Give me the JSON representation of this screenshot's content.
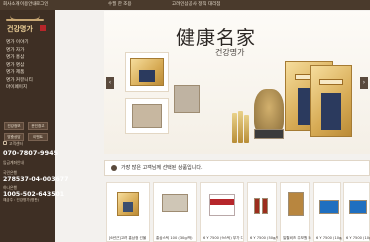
{
  "topbar": {
    "links": [
      "회사소개",
      "이용안내",
      "로그인"
    ],
    "center_link": "수필 한 조용",
    "right_link": "고려인삼공사 정직 대리점"
  },
  "sidebar": {
    "logo_text": "건강명가",
    "menu": [
      "명가 이야기",
      "명가 자가",
      "명가 홍삼",
      "명가 명삼",
      "명가 제품",
      "명가 커뮤니티",
      "마이페이지"
    ],
    "buttons": [
      "건강정보",
      "운인창고",
      "맞춤상담",
      "이벤트"
    ],
    "customer_center_label": "고객센터",
    "phone": "070-7807-9945",
    "quick_label": "입금계좌안내",
    "bank_label": "국민은행",
    "bank_number": "278537-04-003677",
    "bank2_label": "하나은행",
    "bank2_number": "1005-502-643501",
    "holder": "예금주 : 건강명가(명판)"
  },
  "banner": {
    "title_cn": "健康名家",
    "title_kr": "건강명가",
    "prev": "‹",
    "next": "›"
  },
  "promo": {
    "text": "가장 많은 고객님께 선택된 상품입니다."
  },
  "products": [
    {
      "name": "[6년근]고려 홍삼정 선물"
    },
    {
      "name": "홍삼스틱 100 (30g/박)"
    },
    {
      "name": "6 Y 7500 (9스틱) 부가 다"
    },
    {
      "name": "6 Y 7500 (50g/박) 부가 다"
    },
    {
      "name": "일월비즈 주보원 50g (6g/박)"
    },
    {
      "name": "6 Y 7500 (10g/박) 부가 다"
    },
    {
      "name": "6 Y 7500 (10g/박) 부가 다"
    }
  ],
  "colors": {
    "topbar": "#4a3a2c",
    "sidebar": "#3e2f24",
    "accent_gold": "#d7ab55"
  }
}
